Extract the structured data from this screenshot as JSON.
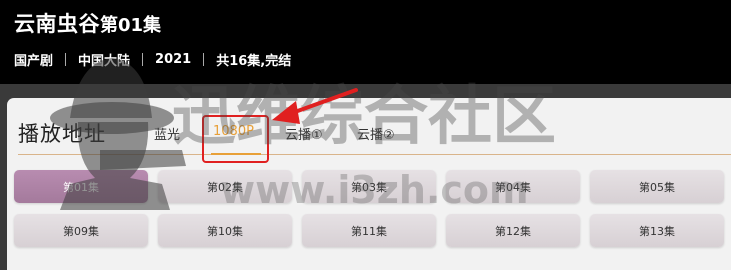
{
  "header": {
    "title": "云南虫谷",
    "episode": "第01集",
    "meta": [
      "国产剧",
      "中国大陆",
      "2021",
      "共16集,完结"
    ]
  },
  "player": {
    "section_title": "播放地址",
    "sources": [
      "蓝光",
      "1080P",
      "云播①",
      "云播②"
    ],
    "active_source": "1080P",
    "episodes_row1": [
      "第01集",
      "第02集",
      "第03集",
      "第04集",
      "第05集"
    ],
    "episodes_row2": [
      "第09集",
      "第10集",
      "第11集",
      "第12集",
      "第13集"
    ],
    "active_episode": "第01集"
  },
  "watermark": {
    "text": "迅维综合社区",
    "url": "www.i3zh.com"
  },
  "colors": {
    "accent": "#e8a038",
    "annotation": "#e02020",
    "active_episode": "#a47a9c"
  }
}
